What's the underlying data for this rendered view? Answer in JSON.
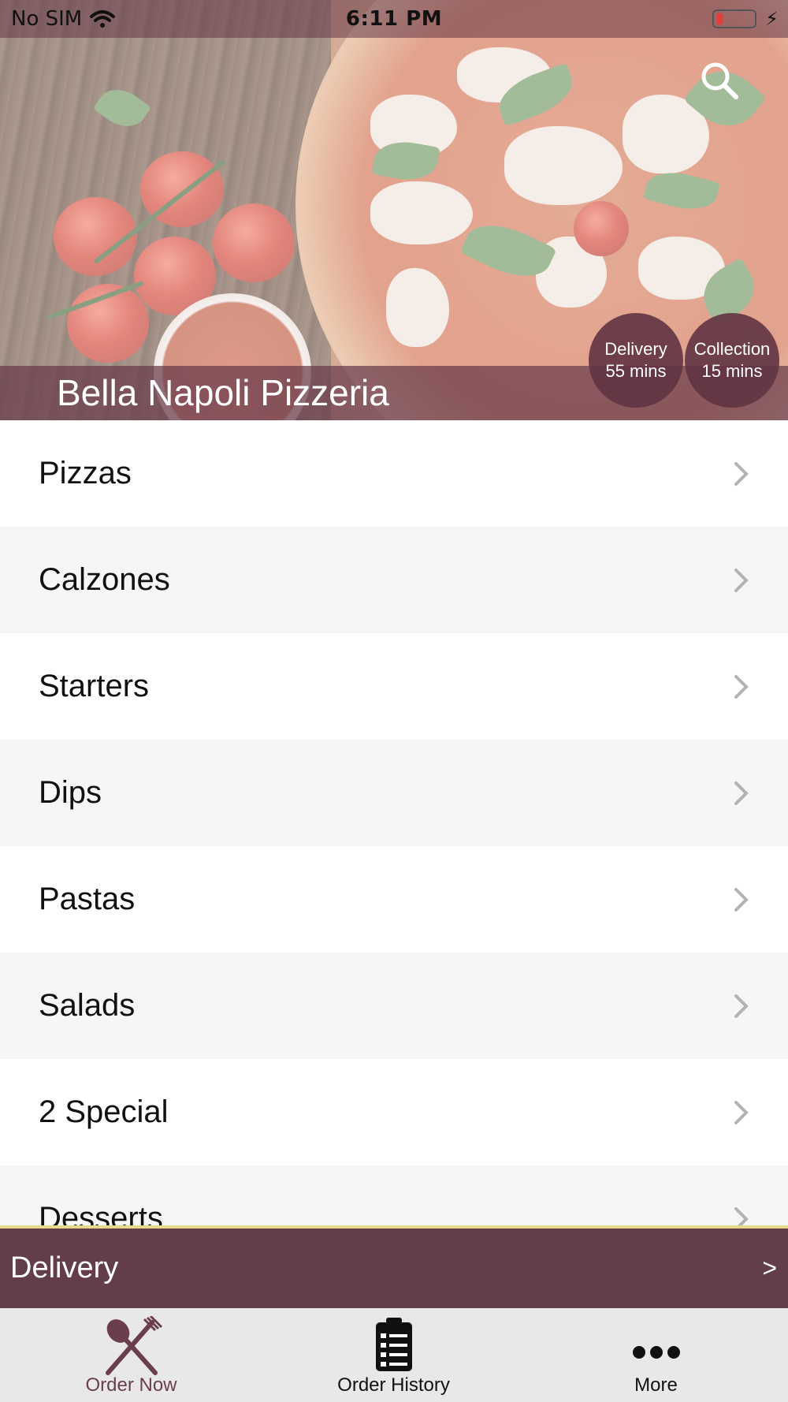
{
  "status_bar": {
    "carrier": "No SIM",
    "time": "6:11 PM"
  },
  "hero": {
    "restaurant_name": "Bella Napoli Pizzeria",
    "delivery_badge": {
      "label": "Delivery",
      "time": "55 mins"
    },
    "collection_badge": {
      "label": "Collection",
      "time": "15 mins"
    }
  },
  "menu": {
    "categories": [
      {
        "label": "Pizzas"
      },
      {
        "label": "Calzones"
      },
      {
        "label": "Starters"
      },
      {
        "label": "Dips"
      },
      {
        "label": "Pastas"
      },
      {
        "label": "Salads"
      },
      {
        "label": "2 Special"
      },
      {
        "label": "Desserts"
      }
    ]
  },
  "delivery_bar": {
    "label": "Delivery",
    "arrow": ">"
  },
  "tab_bar": {
    "tabs": [
      {
        "label": "Order Now",
        "icon": "fork-knife-icon",
        "active": true
      },
      {
        "label": "Order History",
        "icon": "clipboard-list-icon",
        "active": false
      },
      {
        "label": "More",
        "icon": "more-dots-icon",
        "active": false
      }
    ]
  },
  "colors": {
    "brand": "#643d4c",
    "active_tab": "#6b3e4e",
    "row_alt": "#f6f6f6",
    "tab_bar_bg": "#e8e8e8",
    "accent_line": "#e8d88c"
  }
}
